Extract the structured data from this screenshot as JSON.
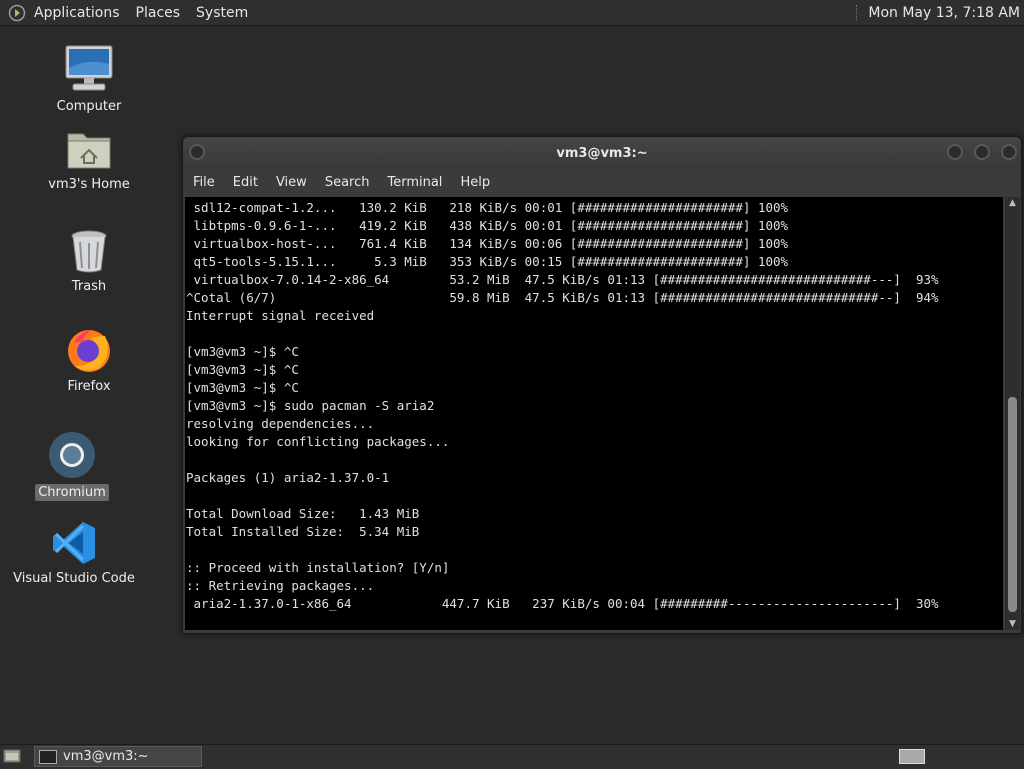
{
  "top_panel": {
    "menus": [
      "Applications",
      "Places",
      "System"
    ],
    "clock": "Mon May 13,  7:18 AM"
  },
  "desktop": {
    "icons": [
      {
        "label": "Computer",
        "icon": "computer-icon"
      },
      {
        "label": "vm3's Home",
        "icon": "home-folder-icon"
      },
      {
        "label": "Trash",
        "icon": "trash-icon"
      },
      {
        "label": "Firefox",
        "icon": "firefox-icon"
      },
      {
        "label": "Chromium",
        "icon": "chromium-icon",
        "selected": true
      },
      {
        "label": "Visual Studio Code",
        "icon": "vscode-icon"
      }
    ]
  },
  "terminal": {
    "title": "vm3@vm3:~",
    "menu": [
      "File",
      "Edit",
      "View",
      "Search",
      "Terminal",
      "Help"
    ],
    "lines": [
      " sdl12-compat-1.2...   130.2 KiB   218 KiB/s 00:01 [######################] 100%",
      " libtpms-0.9.6-1-...   419.2 KiB   438 KiB/s 00:01 [######################] 100%",
      " virtualbox-host-...   761.4 KiB   134 KiB/s 00:06 [######################] 100%",
      " qt5-tools-5.15.1...     5.3 MiB   353 KiB/s 00:15 [######################] 100%",
      " virtualbox-7.0.14-2-x86_64        53.2 MiB  47.5 KiB/s 01:13 [############################---]  93%",
      "^Cotal (6/7)                       59.8 MiB  47.5 KiB/s 01:13 [#############################--]  94%",
      "Interrupt signal received",
      "",
      "[vm3@vm3 ~]$ ^C",
      "[vm3@vm3 ~]$ ^C",
      "[vm3@vm3 ~]$ ^C",
      "[vm3@vm3 ~]$ sudo pacman -S aria2",
      "resolving dependencies...",
      "looking for conflicting packages...",
      "",
      "Packages (1) aria2-1.37.0-1",
      "",
      "Total Download Size:   1.43 MiB",
      "Total Installed Size:  5.34 MiB",
      "",
      ":: Proceed with installation? [Y/n]",
      ":: Retrieving packages...",
      " aria2-1.37.0-1-x86_64            447.7 KiB   237 KiB/s 00:04 [#########----------------------]  30%"
    ]
  },
  "taskbar": {
    "window_title": "vm3@vm3:~"
  }
}
